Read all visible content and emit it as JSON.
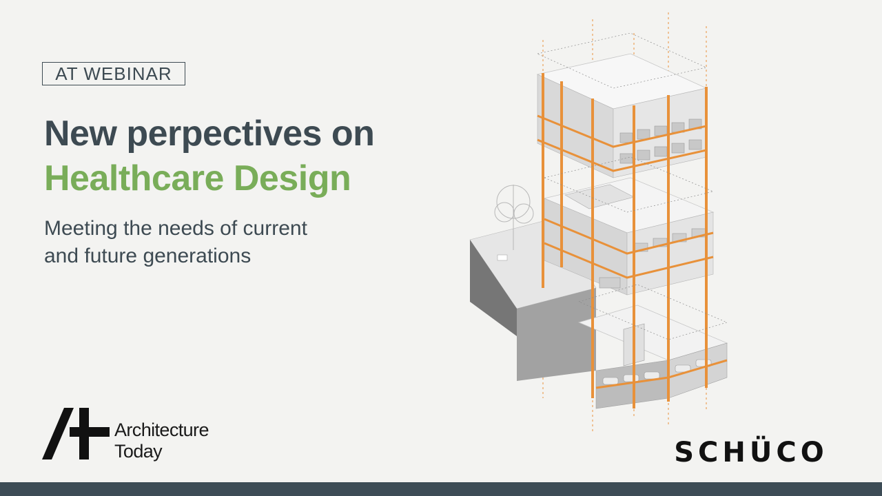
{
  "badge": {
    "label": "AT WEBINAR"
  },
  "headline": {
    "line1": "New perpectives on",
    "line2": "Healthcare Design"
  },
  "subtitle": {
    "line1": "Meeting the needs of current",
    "line2": "and future generations"
  },
  "brands": {
    "architecture_today": {
      "line1": "Architecture",
      "line2": "Today"
    },
    "schuco": "SCHÜCO"
  },
  "colors": {
    "title_dark": "#3d4a52",
    "title_green": "#79ad59",
    "background": "#f3f3f1",
    "footer_bar": "#3d4c56",
    "structure_orange": "#e8913a"
  },
  "illustration": {
    "icon": "isometric-healthcare-building-illustration"
  }
}
